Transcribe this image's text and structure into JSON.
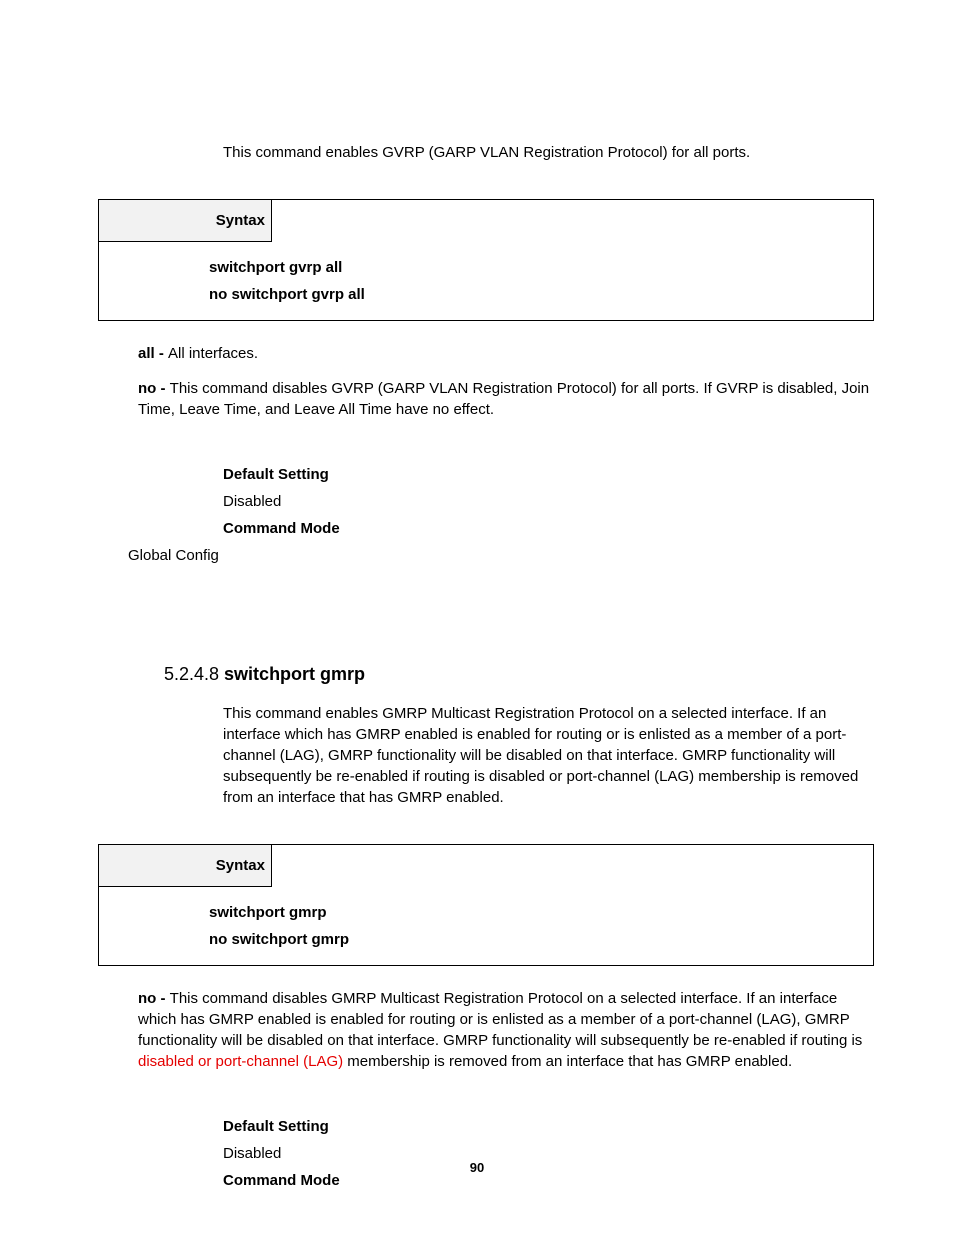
{
  "intro1": "This command enables GVRP (GARP VLAN Registration Protocol) for all ports.",
  "syntaxLabel": "Syntax",
  "box1": {
    "line1": "switchport gvrp all",
    "line2": "no switchport gvrp all"
  },
  "desc1": {
    "allLabel": "all - ",
    "allText": "All interfaces.",
    "noLabel": "no - ",
    "noText": "This command disables GVRP (GARP VLAN Registration Protocol) for all ports. If GVRP is disabled, Join Time, Leave Time, and Leave All Time have no effect."
  },
  "def1": {
    "h1": "Default Setting",
    "v1": "Disabled",
    "h2": "Command Mode",
    "v2": "Global Config"
  },
  "sectionNum": "5.2.4.8 ",
  "sectionTitle": "switchport gmrp",
  "intro2": "This command enables GMRP Multicast Registration Protocol on a selected interface. If an interface which has GMRP enabled is enabled for routing or is enlisted as a member of a port-channel (LAG), GMRP functionality will be disabled on that interface. GMRP functionality will subsequently be re-enabled if routing is disabled or port-channel (LAG) membership is removed from an interface that has GMRP enabled.",
  "box2": {
    "line1": "switchport gmrp",
    "line2": "no switchport gmrp"
  },
  "desc2": {
    "noLabel": "no - ",
    "noTextA": "This command disables GMRP Multicast Registration Protocol on a selected interface. If an interface which has GMRP enabled is enabled for routing or is enlisted as a member of a port-channel (LAG), GMRP functionality will be disabled on that interface. GMRP functionality will subsequently be re-enabled if routing is ",
    "noTextRed": "disabled or port-channel (LAG)",
    "noTextB": " membership is removed from an interface that has GMRP enabled."
  },
  "def2": {
    "h1": "Default Setting",
    "v1": "Disabled",
    "h2": "Command Mode"
  },
  "pageNum": "90"
}
